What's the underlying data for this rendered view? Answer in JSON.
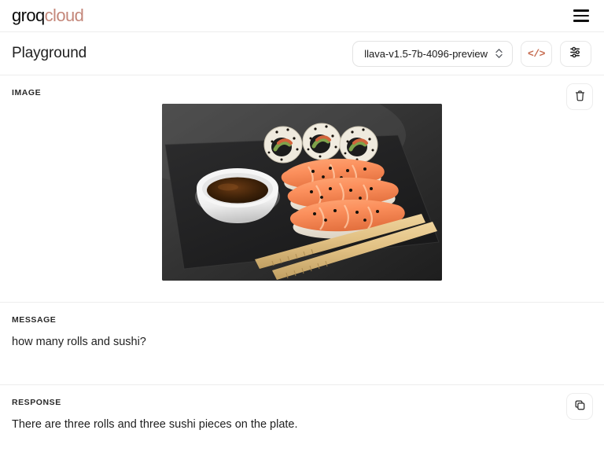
{
  "brand": {
    "name_primary": "groq",
    "name_secondary": "cloud",
    "accent_color": "#c4877a",
    "menu_icon": "hamburger-menu-icon"
  },
  "header": {
    "title": "Playground",
    "model_selector": {
      "value": "llava-v1.5-7b-4096-preview",
      "chevron_icon": "chevron-up-down-icon"
    },
    "code_button": {
      "label": "</>",
      "icon": "code-icon",
      "color": "#c66a4e"
    },
    "settings_button": {
      "icon": "sliders-icon"
    }
  },
  "image_section": {
    "label": "IMAGE",
    "delete_button_icon": "trash-icon",
    "image_alt": "Three maki rolls with sesame seeds and three salmon nigiri on a dark slate board, with a white bowl of soy sauce and wooden chopsticks"
  },
  "message_section": {
    "label": "MESSAGE",
    "text": "how many rolls and sushi?"
  },
  "response_section": {
    "label": "RESPONSE",
    "text": "There are three rolls and three sushi pieces on the plate.",
    "copy_button_icon": "copy-icon"
  }
}
